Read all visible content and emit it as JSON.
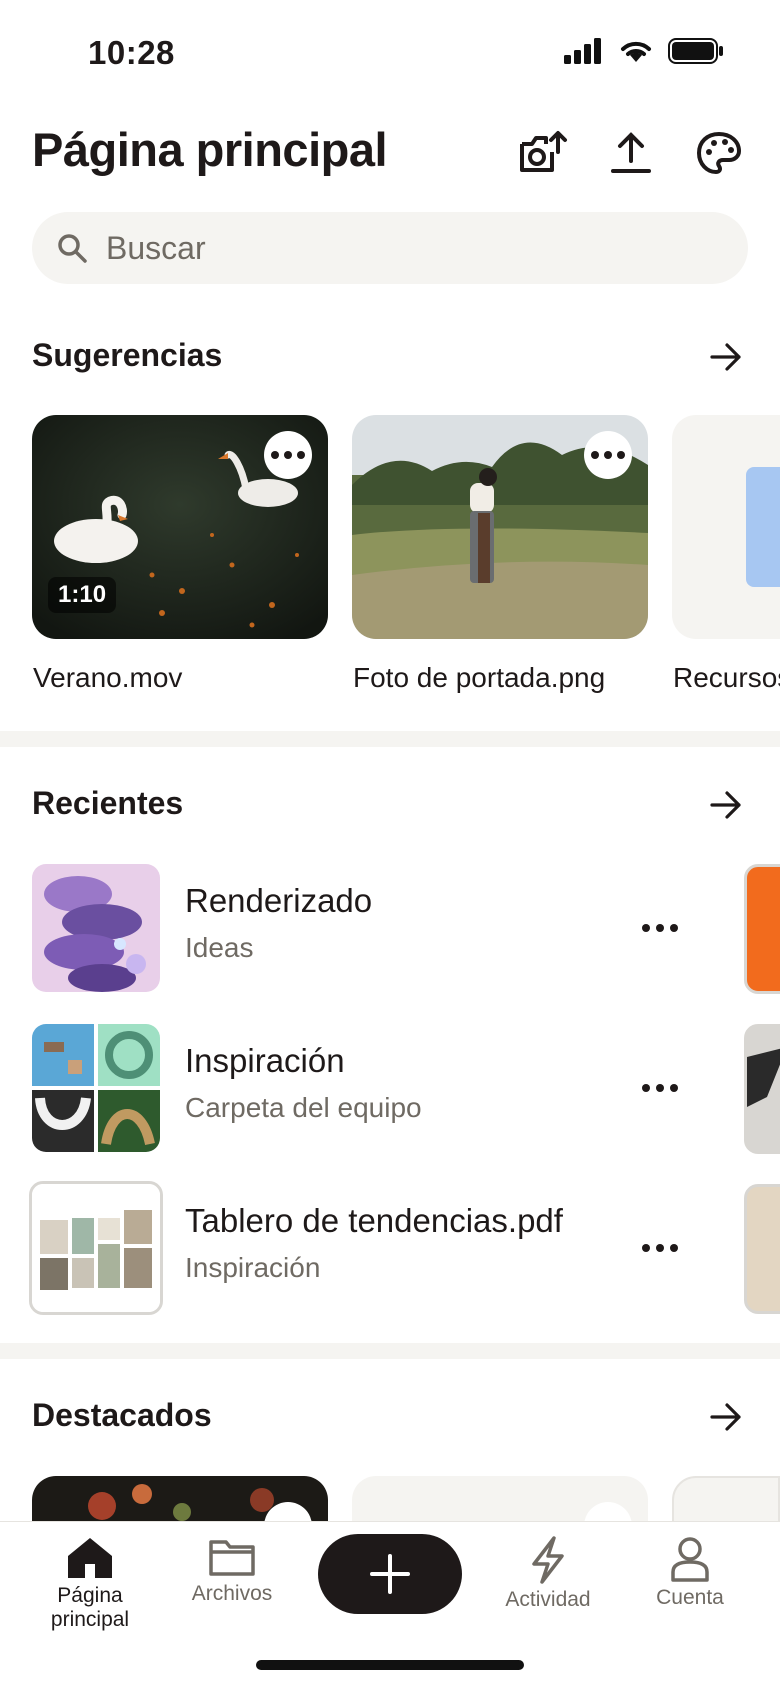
{
  "status_bar": {
    "time": "10:28"
  },
  "header": {
    "title": "Página principal"
  },
  "search": {
    "placeholder": "Buscar"
  },
  "suggestions": {
    "title": "Sugerencias",
    "cards": [
      {
        "label": "Verano.mov",
        "duration": "1:10"
      },
      {
        "label": "Foto de portada.png"
      },
      {
        "label": "Recursos"
      }
    ]
  },
  "recents": {
    "title": "Recientes",
    "items": [
      {
        "name": "Renderizado",
        "sub": "Ideas"
      },
      {
        "name": "Inspiración",
        "sub": "Carpeta del equipo"
      },
      {
        "name": "Tablero de tendencias.pdf",
        "sub": "Inspiración"
      }
    ]
  },
  "featured": {
    "title": "Destacados"
  },
  "nav": {
    "home": "Página principal",
    "files": "Archivos",
    "activity": "Actividad",
    "account": "Cuenta"
  },
  "colors": {
    "text": "#1e1919",
    "muted": "#6f6a63",
    "surface": "#f5f4f1",
    "accent_orange": "#f26b1d"
  },
  "icons": [
    "camera-upload-icon",
    "upload-icon",
    "palette-icon",
    "search-icon",
    "arrow-right-icon",
    "more-icon",
    "home-icon",
    "folder-icon",
    "bolt-icon",
    "person-icon",
    "plus-icon"
  ]
}
